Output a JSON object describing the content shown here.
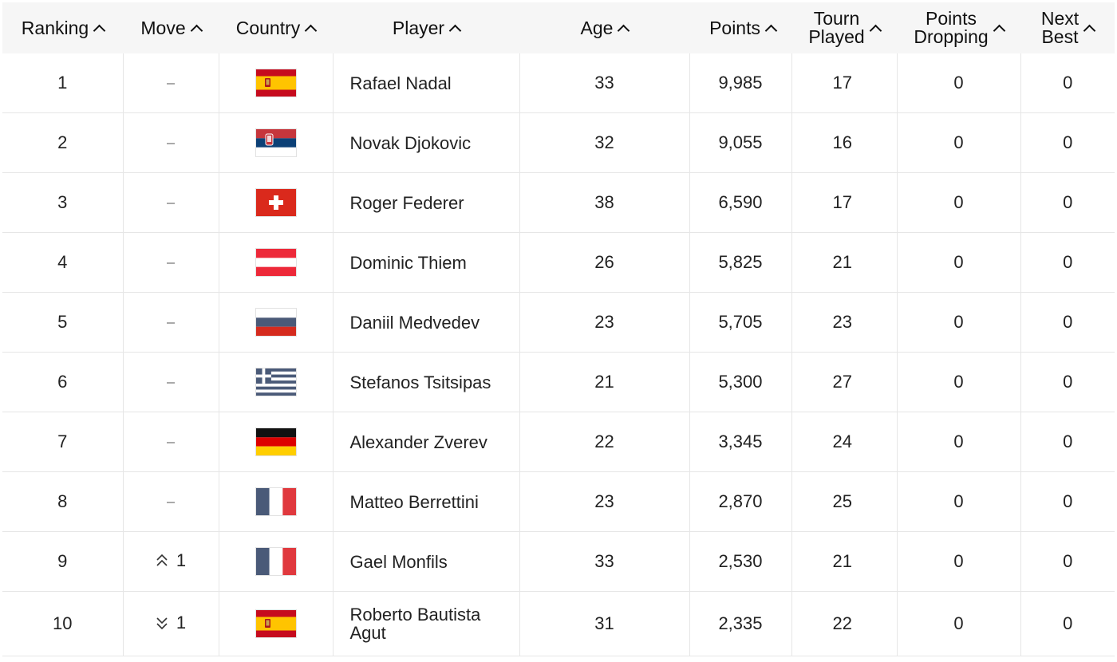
{
  "headers": {
    "ranking": "Ranking",
    "move": "Move",
    "country": "Country",
    "player": "Player",
    "age": "Age",
    "points": "Points",
    "tourn_line1": "Tourn",
    "tourn_line2": "Played",
    "dropping_line1": "Points",
    "dropping_line2": "Dropping",
    "next_line1": "Next",
    "next_line2": "Best"
  },
  "rows": [
    {
      "ranking": "1",
      "move": "",
      "move_dir": "none",
      "flag": "spain-flag-icon",
      "player": "Rafael Nadal",
      "age": "33",
      "points": "9,985",
      "tourn_played": "17",
      "points_dropping": "0",
      "next_best": "0"
    },
    {
      "ranking": "2",
      "move": "",
      "move_dir": "none",
      "flag": "serbia-flag-icon",
      "player": "Novak Djokovic",
      "age": "32",
      "points": "9,055",
      "tourn_played": "16",
      "points_dropping": "0",
      "next_best": "0"
    },
    {
      "ranking": "3",
      "move": "",
      "move_dir": "none",
      "flag": "switzerland-flag-icon",
      "player": "Roger Federer",
      "age": "38",
      "points": "6,590",
      "tourn_played": "17",
      "points_dropping": "0",
      "next_best": "0"
    },
    {
      "ranking": "4",
      "move": "",
      "move_dir": "none",
      "flag": "austria-flag-icon",
      "player": "Dominic Thiem",
      "age": "26",
      "points": "5,825",
      "tourn_played": "21",
      "points_dropping": "0",
      "next_best": "0"
    },
    {
      "ranking": "5",
      "move": "",
      "move_dir": "none",
      "flag": "russia-flag-icon",
      "player": "Daniil Medvedev",
      "age": "23",
      "points": "5,705",
      "tourn_played": "23",
      "points_dropping": "0",
      "next_best": "0"
    },
    {
      "ranking": "6",
      "move": "",
      "move_dir": "none",
      "flag": "greece-flag-icon",
      "player": "Stefanos Tsitsipas",
      "age": "21",
      "points": "5,300",
      "tourn_played": "27",
      "points_dropping": "0",
      "next_best": "0"
    },
    {
      "ranking": "7",
      "move": "",
      "move_dir": "none",
      "flag": "germany-flag-icon",
      "player": "Alexander Zverev",
      "age": "22",
      "points": "3,345",
      "tourn_played": "24",
      "points_dropping": "0",
      "next_best": "0"
    },
    {
      "ranking": "8",
      "move": "",
      "move_dir": "none",
      "flag": "italy-flag-icon",
      "player": "Matteo Berrettini",
      "age": "23",
      "points": "2,870",
      "tourn_played": "25",
      "points_dropping": "0",
      "next_best": "0"
    },
    {
      "ranking": "9",
      "move": "1",
      "move_dir": "up",
      "flag": "france-flag-icon",
      "player": "Gael Monfils",
      "age": "33",
      "points": "2,530",
      "tourn_played": "21",
      "points_dropping": "0",
      "next_best": "0"
    },
    {
      "ranking": "10",
      "move": "1",
      "move_dir": "down",
      "flag": "spain-flag-icon",
      "player": "Roberto Bautista Agut",
      "age": "31",
      "points": "2,335",
      "tourn_played": "22",
      "points_dropping": "0",
      "next_best": "0"
    }
  ],
  "colors": {
    "header_bg": "#f6f6f6",
    "grid_line": "#e6e6e6",
    "text": "#222222"
  }
}
